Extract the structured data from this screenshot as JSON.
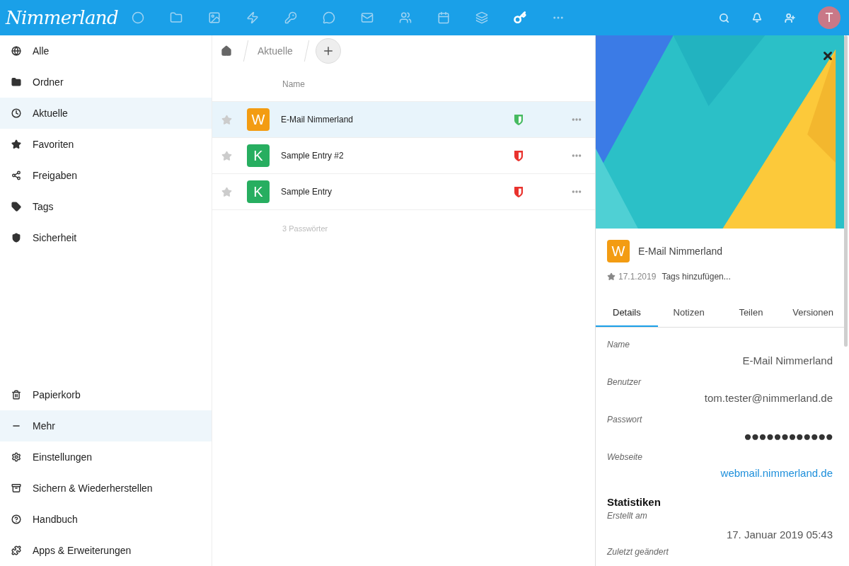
{
  "topbar": {
    "logo": "Nimmerland",
    "apps": [
      {
        "selected": false
      },
      {
        "selected": false
      },
      {
        "selected": false
      },
      {
        "selected": false
      },
      {
        "selected": false
      },
      {
        "selected": false
      },
      {
        "selected": false
      },
      {
        "selected": false
      },
      {
        "selected": false
      },
      {
        "selected": false
      },
      {
        "selected": true
      },
      {
        "selected": false
      }
    ],
    "avatar": "T"
  },
  "sidebar": {
    "items": [
      {
        "label": "Alle",
        "selected": false
      },
      {
        "label": "Ordner",
        "selected": false
      },
      {
        "label": "Aktuelle",
        "selected": true
      },
      {
        "label": "Favoriten",
        "selected": false
      },
      {
        "label": "Freigaben",
        "selected": false
      },
      {
        "label": "Tags",
        "selected": false
      },
      {
        "label": "Sicherheit",
        "selected": false
      }
    ],
    "footer_items": [
      {
        "label": "Papierkorb",
        "selected": false
      },
      {
        "label": "Mehr",
        "selected": true
      },
      {
        "label": "Einstellungen",
        "selected": false
      },
      {
        "label": "Sichern & Wiederherstellen",
        "selected": false
      },
      {
        "label": "Handbuch",
        "selected": false
      },
      {
        "label": "Apps & Erweiterungen",
        "selected": false
      }
    ]
  },
  "breadcrumb": {
    "items": [
      "Aktuelle"
    ]
  },
  "list": {
    "column": "Name",
    "rows": [
      {
        "letter": "W",
        "color": "#f39c12",
        "name": "E-Mail Nimmerland",
        "secure": true,
        "favorite": false,
        "selected": true
      },
      {
        "letter": "K",
        "color": "#27ae60",
        "name": "Sample Entry #2",
        "secure": false,
        "favorite": false,
        "selected": false
      },
      {
        "letter": "K",
        "color": "#27ae60",
        "name": "Sample Entry",
        "secure": false,
        "favorite": false,
        "selected": false
      }
    ],
    "footer": "3 Passwörter"
  },
  "details": {
    "letter": "W",
    "color": "#f39c12",
    "title": "E-Mail Nimmerland",
    "favorite": true,
    "date": "17.1.2019",
    "tags_placeholder": "Tags hinzufügen...",
    "tabs": [
      {
        "label": "Details",
        "selected": true
      },
      {
        "label": "Notizen",
        "selected": false
      },
      {
        "label": "Teilen",
        "selected": false
      },
      {
        "label": "Versionen",
        "selected": false
      }
    ],
    "fields": [
      {
        "label": "Name",
        "value": "E-Mail Nimmerland",
        "kind": "text"
      },
      {
        "label": "Benutzer",
        "value": "tom.tester@nimmerland.de",
        "kind": "text"
      },
      {
        "label": "Passwort",
        "value": "●●●●●●●●●●●●",
        "kind": "password"
      },
      {
        "label": "Webseite",
        "value": "webmail.nimmerland.de",
        "kind": "link"
      }
    ],
    "stats_heading": "Statistiken",
    "stats": [
      {
        "label": "Erstellt am",
        "value": "17. Januar 2019 05:43"
      },
      {
        "label": "Zuletzt geändert"
      }
    ]
  }
}
